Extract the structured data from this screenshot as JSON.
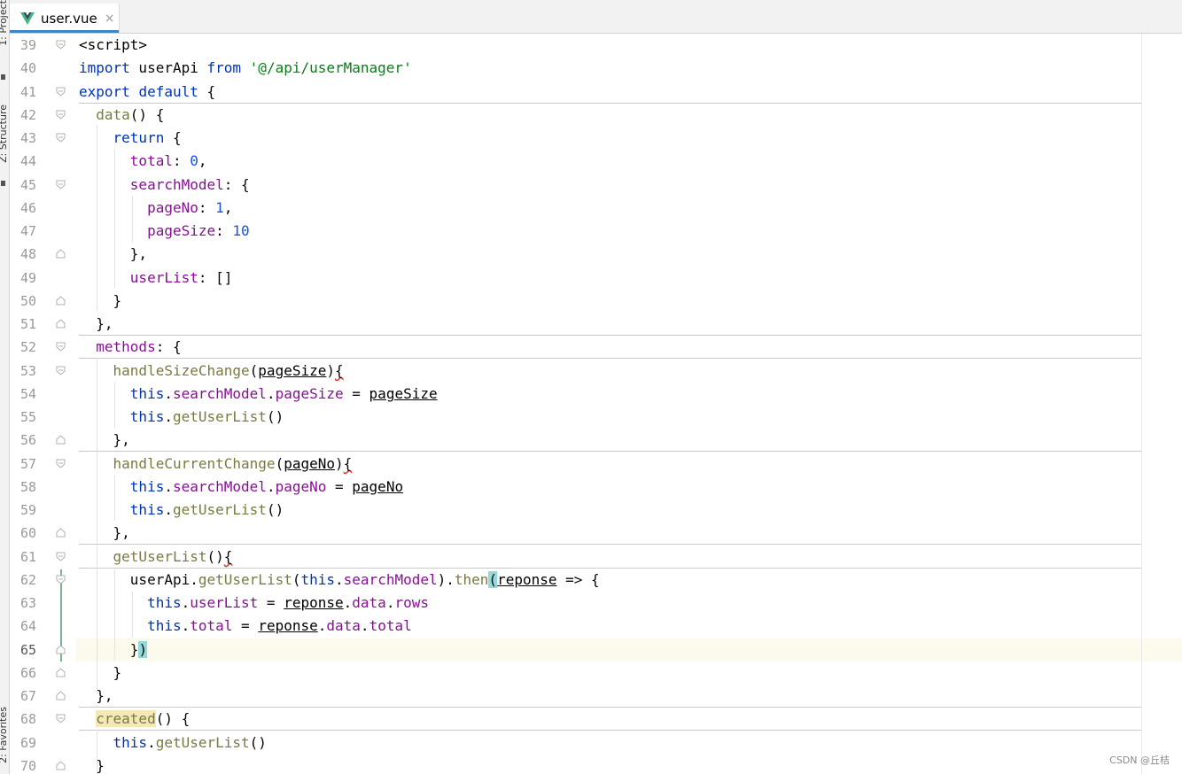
{
  "tab": {
    "label": "user.vue",
    "close": "×",
    "active": true
  },
  "toolstrip": {
    "project_label": "1: Project",
    "structure_label": "Z: Structure",
    "favorites_label": "2: Favorites"
  },
  "editor": {
    "current_line": 65,
    "lines": [
      {
        "n": "39"
      },
      {
        "n": "40"
      },
      {
        "n": "41"
      },
      {
        "n": "42"
      },
      {
        "n": "43"
      },
      {
        "n": "44"
      },
      {
        "n": "45"
      },
      {
        "n": "46"
      },
      {
        "n": "47"
      },
      {
        "n": "48"
      },
      {
        "n": "49"
      },
      {
        "n": "50"
      },
      {
        "n": "51"
      },
      {
        "n": "52"
      },
      {
        "n": "53"
      },
      {
        "n": "54"
      },
      {
        "n": "55"
      },
      {
        "n": "56"
      },
      {
        "n": "57"
      },
      {
        "n": "58"
      },
      {
        "n": "59"
      },
      {
        "n": "60"
      },
      {
        "n": "61"
      },
      {
        "n": "62"
      },
      {
        "n": "63"
      },
      {
        "n": "64"
      },
      {
        "n": "65"
      },
      {
        "n": "66"
      },
      {
        "n": "67"
      },
      {
        "n": "68"
      },
      {
        "n": "69"
      },
      {
        "n": "70"
      }
    ],
    "tokens": {
      "l39": "<script>",
      "l40_kw1": "import",
      "l40_id": " userApi ",
      "l40_kw2": "from",
      "l40_sp": " ",
      "l40_str": "'@/api/userManager'",
      "l41_kw1": "export",
      "l41_sp": " ",
      "l41_kw2": "default",
      "l41_rest": " {",
      "l42_ind": "  ",
      "l42_fn": "data",
      "l42_rest": "() {",
      "l43_ind": "    ",
      "l43_kw": "return",
      "l43_rest": " {",
      "l44_ind": "      ",
      "l44_prop": "total",
      "l44_colon": ": ",
      "l44_num": "0",
      "l44_rest": ",",
      "l45_ind": "      ",
      "l45_prop": "searchModel",
      "l45_rest": ": {",
      "l46_ind": "        ",
      "l46_prop": "pageNo",
      "l46_colon": ": ",
      "l46_num": "1",
      "l46_rest": ",",
      "l47_ind": "        ",
      "l47_prop": "pageSize",
      "l47_colon": ": ",
      "l47_num": "10",
      "l48": "      },",
      "l49_ind": "      ",
      "l49_prop": "userList",
      "l49_rest": ": []",
      "l50": "    }",
      "l51": "  },",
      "l52_ind": "  ",
      "l52_prop": "methods",
      "l52_rest": ": {",
      "l53_ind": "    ",
      "l53_fn": "handleSizeChange",
      "l53_p1": "(",
      "l53_param": "pageSize",
      "l53_p2": ")",
      "l53_brace": "{",
      "l54_ind": "      ",
      "l54_kw": "this",
      "l54_dot1": ".",
      "l54_prop1": "searchModel",
      "l54_dot2": ".",
      "l54_prop2": "pageSize",
      "l54_eq": " = ",
      "l54_param": "pageSize",
      "l55_ind": "      ",
      "l55_kw": "this",
      "l55_dot": ".",
      "l55_fn": "getUserList",
      "l55_rest": "()",
      "l56": "    },",
      "l57_ind": "    ",
      "l57_fn": "handleCurrentChange",
      "l57_p1": "(",
      "l57_param": "pageNo",
      "l57_p2": ")",
      "l57_brace": "{",
      "l58_ind": "      ",
      "l58_kw": "this",
      "l58_dot1": ".",
      "l58_prop1": "searchModel",
      "l58_dot2": ".",
      "l58_prop2": "pageNo",
      "l58_eq": " = ",
      "l58_param": "pageNo",
      "l59_ind": "      ",
      "l59_kw": "this",
      "l59_dot": ".",
      "l59_fn": "getUserList",
      "l59_rest": "()",
      "l60": "    },",
      "l61_ind": "    ",
      "l61_fn": "getUserList",
      "l61_p": "()",
      "l61_brace": "{",
      "l62_ind": "      ",
      "l62_id": "userApi",
      "l62_dot1": ".",
      "l62_fn": "getUserList",
      "l62_p1": "(",
      "l62_kw": "this",
      "l62_dot2": ".",
      "l62_prop": "searchModel",
      "l62_p2": ").",
      "l62_fn2": "then",
      "l62_paren": "(",
      "l62_param": "reponse",
      "l62_rest": " => {",
      "l63_ind": "        ",
      "l63_kw": "this",
      "l63_dot1": ".",
      "l63_prop1": "userList",
      "l63_eq": " = ",
      "l63_param": "reponse",
      "l63_dot2": ".",
      "l63_prop2": "data",
      "l63_dot3": ".",
      "l63_prop3": "rows",
      "l64_ind": "        ",
      "l64_kw": "this",
      "l64_dot1": ".",
      "l64_prop1": "total",
      "l64_eq": " = ",
      "l64_param": "reponse",
      "l64_dot2": ".",
      "l64_prop2": "data",
      "l64_dot3": ".",
      "l64_prop3": "total",
      "l65_ind": "      }",
      "l65_paren": ")",
      "l66": "    }",
      "l67": "  },",
      "l68_ind": "  ",
      "l68_fn": "created",
      "l68_rest": "() {",
      "l69_ind": "    ",
      "l69_kw": "this",
      "l69_dot": ".",
      "l69_fn": "getUserList",
      "l69_rest": "()",
      "l70": "  }"
    }
  },
  "watermark": "CSDN @丘桔",
  "colors": {
    "keyword": "#0033b3",
    "string": "#067d17",
    "number": "#1750eb",
    "property": "#871094",
    "method": "#7a7a43",
    "current_line_bg": "#fcfaed",
    "brace_match": "#93d9d9"
  }
}
